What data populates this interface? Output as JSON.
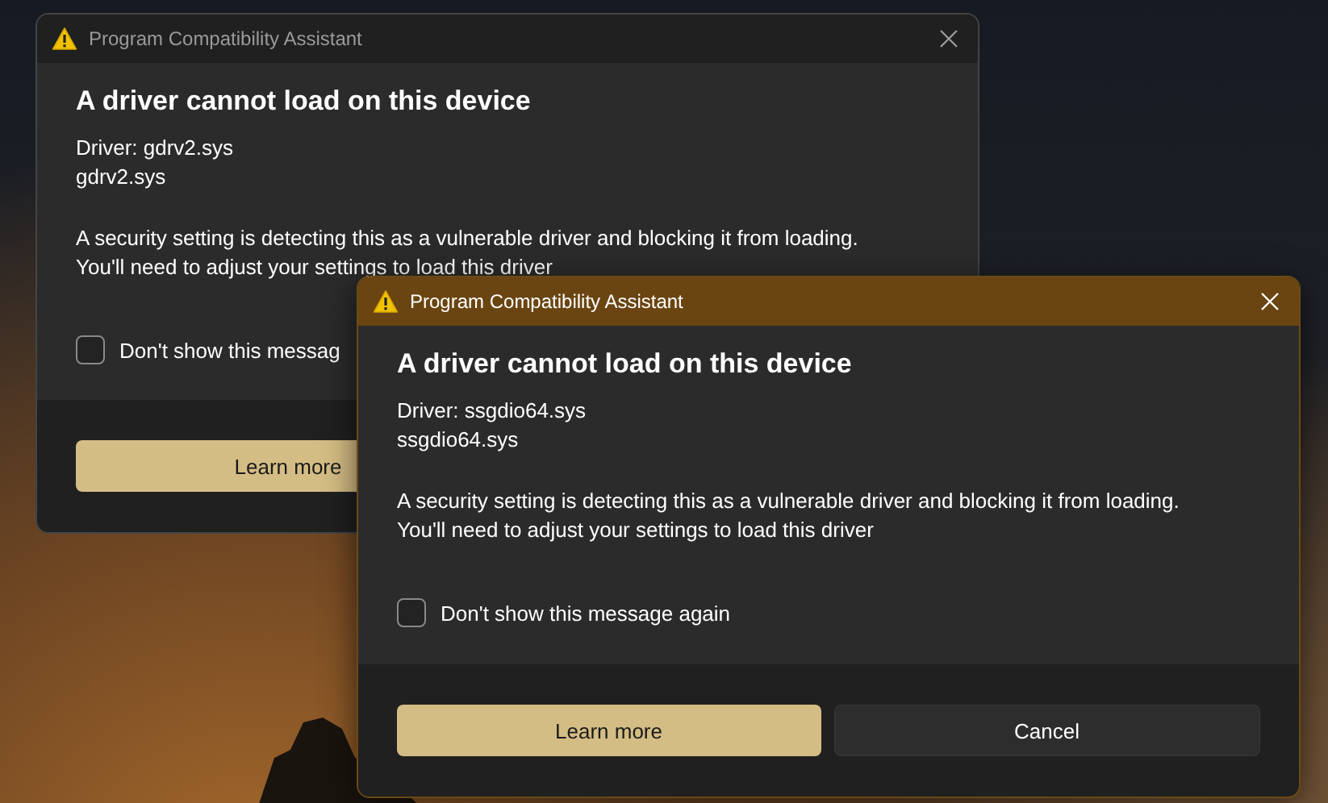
{
  "windows": [
    {
      "title": "Program Compatibility Assistant",
      "active": false,
      "heading": "A driver cannot load on this device",
      "driver_lines": [
        "Driver: gdrv2.sys",
        "gdrv2.sys"
      ],
      "message_lines": [
        "A security setting is detecting this as a vulnerable driver and blocking it from loading.",
        "You'll need to adjust your settings to load this driver"
      ],
      "checkbox": {
        "label": "Don't show this messag",
        "checked": false
      },
      "buttons": [
        {
          "label": "Learn more",
          "kind": "primary"
        }
      ]
    },
    {
      "title": "Program Compatibility Assistant",
      "active": true,
      "heading": "A driver cannot load on this device",
      "driver_lines": [
        "Driver: ssgdio64.sys",
        "ssgdio64.sys"
      ],
      "message_lines": [
        "A security setting is detecting this as a vulnerable driver and blocking it from loading.",
        "You'll need to adjust your settings to load this driver"
      ],
      "checkbox": {
        "label": "Don't show this message again",
        "checked": false
      },
      "buttons": [
        {
          "label": "Learn more",
          "kind": "primary"
        },
        {
          "label": "Cancel",
          "kind": "secondary"
        }
      ]
    }
  ]
}
